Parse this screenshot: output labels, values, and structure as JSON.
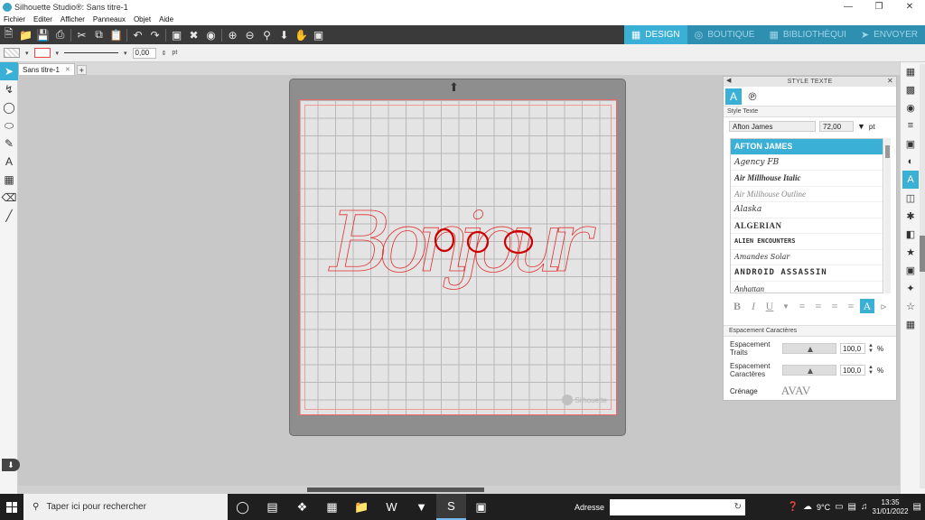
{
  "window": {
    "title": "Silhouette Studio®: Sans titre-1"
  },
  "menu": [
    "Fichier",
    "Editer",
    "Afficher",
    "Panneaux",
    "Objet",
    "Aide"
  ],
  "modes": [
    {
      "label": "DESIGN",
      "active": true
    },
    {
      "label": "BOUTIQUE",
      "active": false
    },
    {
      "label": "BIBLIOTHÈQUI",
      "active": false
    },
    {
      "label": "ENVOYER",
      "active": false
    }
  ],
  "props": {
    "line_width": "0,00",
    "unit": "pt"
  },
  "doc_tab": {
    "label": "Sans titre-1",
    "add": "+"
  },
  "canvas": {
    "text": "Bonjour",
    "watermark": "Silhouette",
    "line_color": "#e23030",
    "highlight_color": "#cc0000"
  },
  "panel": {
    "title": "STYLE TEXTE",
    "section_style": "Style Texte",
    "font_name": "Afton James",
    "font_size": "72,00",
    "font_unit": "pt",
    "fonts": [
      "AFTON JAMES",
      "Agency FB",
      "Air Millhouse Italic",
      "Air Millhouse Outline",
      "Alaska",
      "ALGERIAN",
      "ALIEN ENCOUNTERS",
      "Amandes Solar",
      "ANDROID ASSASSIN",
      "Anhattan"
    ],
    "format_buttons": [
      "B",
      "I",
      "U"
    ],
    "section_spacing": "Espacement Caractères",
    "line_spacing_label": "Espacement Traits",
    "line_spacing_value": "100,0",
    "char_spacing_label": "Espacement Caractères",
    "char_spacing_value": "100,0",
    "percent": "%",
    "kerning_label": "Crénage",
    "kerning_sample": "AVAV"
  },
  "taskbar": {
    "search_placeholder": "Taper ici pour rechercher",
    "address_label": "Adresse",
    "temperature": "9°C",
    "time": "13:35",
    "date": "31/01/2022"
  }
}
